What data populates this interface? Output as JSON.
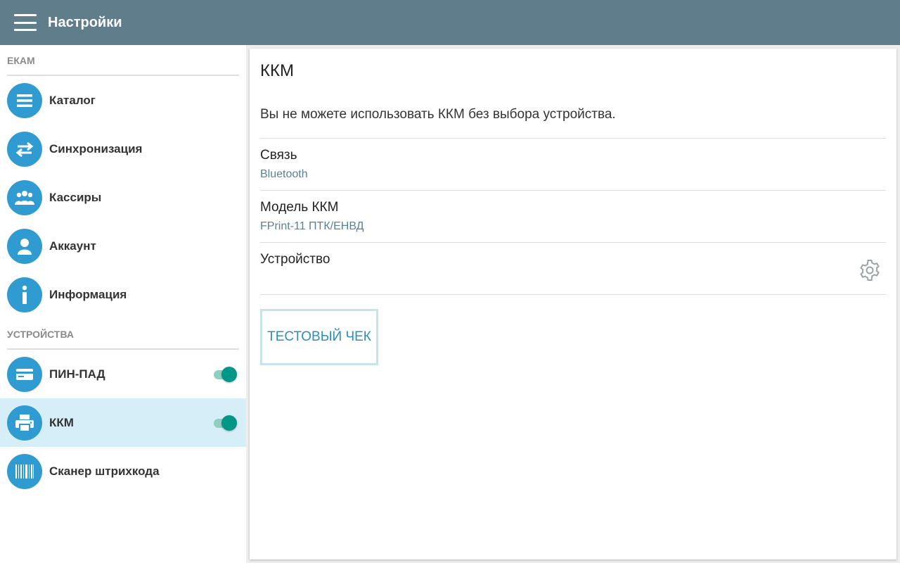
{
  "topbar": {
    "title": "Настройки"
  },
  "sidebar": {
    "section1": "ЕКАМ",
    "section2": "УСТРОЙСТВА",
    "items": [
      {
        "label": "Каталог",
        "icon": "list-icon"
      },
      {
        "label": "Синхронизация",
        "icon": "sync-arrows-icon"
      },
      {
        "label": "Кассиры",
        "icon": "group-icon"
      },
      {
        "label": "Аккаунт",
        "icon": "person-icon"
      },
      {
        "label": "Информация",
        "icon": "info-icon"
      }
    ],
    "devices": [
      {
        "label": "ПИН-ПАД",
        "icon": "card-icon",
        "enabled": true
      },
      {
        "label": "ККМ",
        "icon": "printer-icon",
        "enabled": true,
        "active": true
      },
      {
        "label": "Сканер штрихкода",
        "icon": "barcode-icon"
      }
    ]
  },
  "main": {
    "title": "ККМ",
    "note": "Вы не можете использовать ККМ без выбора устройства.",
    "prefs": [
      {
        "title": "Связь",
        "value": "Bluetooth"
      },
      {
        "title": "Модель ККМ",
        "value": "FPrint-11 ПТК/ЕНВД"
      },
      {
        "title": "Устройство",
        "value": ""
      }
    ],
    "test_button": "ТЕСТОВЫЙ ЧЕК"
  },
  "colors": {
    "topbar": "#607d8b",
    "icon_bg": "#2f9bd1",
    "active_bg": "#d6eef7",
    "toggle_on": "#009688",
    "value_text": "#5b7f95",
    "button_text": "#2b8dc0"
  }
}
